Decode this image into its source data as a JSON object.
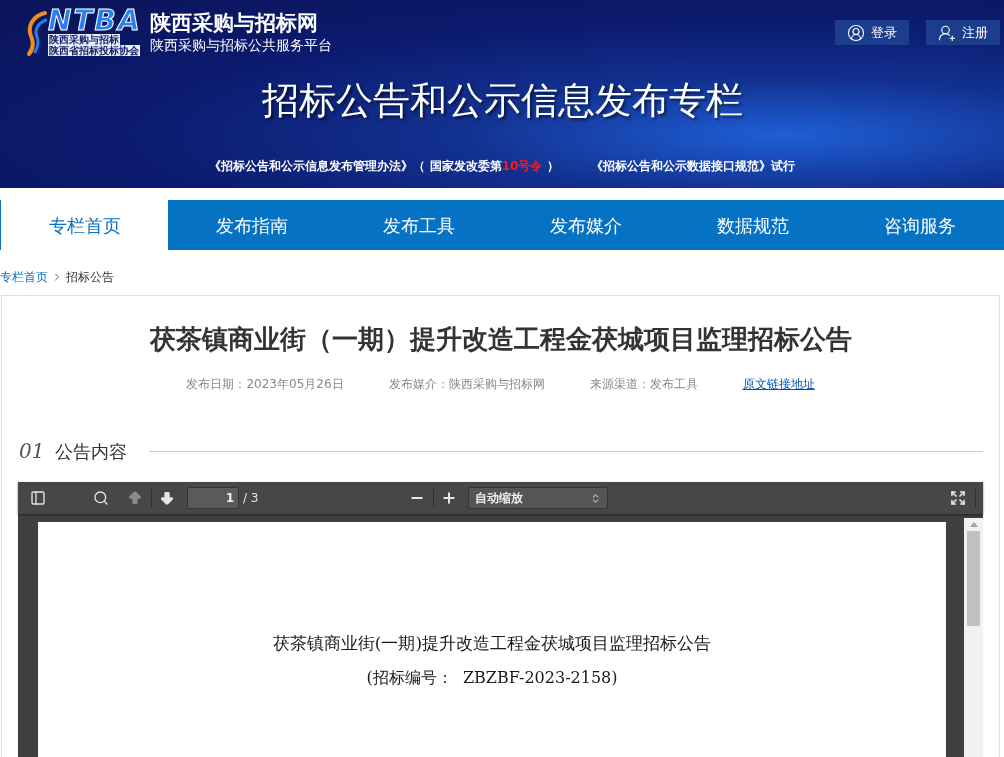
{
  "header": {
    "logo": {
      "letters": "NTBA",
      "caption_lines": [
        "陕西采购与招标",
        "陕西省招标投标协会"
      ]
    },
    "site_name": "陕西采购与招标网",
    "site_subtitle": "陕西采购与招标公共服务平台",
    "account_buttons": [
      {
        "kind": "login",
        "label": "登录"
      },
      {
        "kind": "register",
        "label": "注册"
      }
    ],
    "banner_title": "招标公告和公示信息发布专栏",
    "notices": [
      {
        "segments": [
          {
            "text": "《招标公告和公示信息发布管理办法》（ 国家发改委第",
            "highlight": false
          },
          {
            "text": "10号令",
            "highlight": true
          },
          {
            "text": " ）",
            "highlight": false
          }
        ]
      },
      {
        "segments": [
          {
            "text": "《招标公告和公示数据接口规范》试行",
            "highlight": false
          }
        ]
      }
    ]
  },
  "nav": {
    "tabs": [
      {
        "label": "专栏首页",
        "selected": true
      },
      {
        "label": "发布指南",
        "selected": false
      },
      {
        "label": "发布工具",
        "selected": false
      },
      {
        "label": "发布媒介",
        "selected": false
      },
      {
        "label": "数据规范",
        "selected": false
      },
      {
        "label": "咨询服务",
        "selected": false
      }
    ]
  },
  "breadcrumb": [
    {
      "kind": "link",
      "label": "专栏首页"
    },
    {
      "kind": "current",
      "label": "招标公告"
    }
  ],
  "article": {
    "title": "茯茶镇商业街（一期）提升改造工程金茯城项目监理招标公告",
    "meta": [
      {
        "kind": "text",
        "text": "发布日期：2023年05月26日"
      },
      {
        "kind": "text",
        "text": "发布媒介：陕西采购与招标网"
      },
      {
        "kind": "text",
        "text": "来源渠道：发布工具"
      },
      {
        "kind": "link",
        "text": "原文链接地址"
      }
    ],
    "section": {
      "number": "01",
      "title": "公告内容"
    }
  },
  "pdf_viewer": {
    "toolbar": {
      "previous_page_disabled": true,
      "next_page_disabled": false,
      "page_number": "1",
      "page_count": "/ 3",
      "zoom": "自动缩放"
    },
    "page": {
      "title": "茯茶镇商业街(一期)提升改造工程金茯城项目监理招标公告",
      "reference": "(招标编号：  ZBZBF-2023-2158)"
    }
  }
}
